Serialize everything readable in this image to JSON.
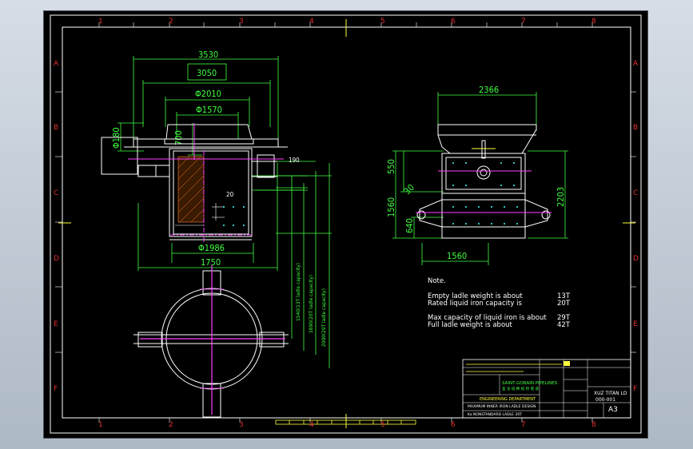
{
  "frame": {
    "columns": [
      "1",
      "2",
      "3",
      "4",
      "5",
      "6",
      "7",
      "8"
    ],
    "rows": [
      "A",
      "B",
      "C",
      "D",
      "E",
      "F"
    ]
  },
  "dimensions": {
    "d3530": "3530",
    "d3050": "3050",
    "dphi2010": "Φ2010",
    "dphi1570": "Φ1570",
    "d700": "700",
    "dphi180": "Φ180",
    "d190": "190",
    "d20": "20",
    "dphi1986": "Φ1986",
    "d1750": "1750",
    "d2366": "2366",
    "d550": "550",
    "d2203": "2203",
    "d1560": "1560",
    "d640": "640",
    "d1560b": "1560",
    "d30": "30",
    "vertical_labels": [
      "1540(13T ladle capacity)",
      "1690(20T ladle capacity)",
      "2000(29T ladle capacity)"
    ]
  },
  "notes": {
    "heading": "Note.",
    "lines": [
      {
        "label": "Empty ladle weight is about",
        "value": "13T"
      },
      {
        "label": "Rated liquid iron capacity is",
        "value": "20T"
      },
      {
        "label": "Max capacity of liquid iron is about",
        "value": "29T"
      },
      {
        "label": "Full ladle weight is about",
        "value": "42T"
      }
    ]
  },
  "title_block": {
    "company": "SAINT-GOBAIN PIPELINES",
    "company_sub": "圣 戈 班 穆 松 桥 管 道",
    "project": "ENGINEERING DEPARTMENT",
    "drawing_title_1": "MAXIMUM INNER IRON LADLE DESIGN",
    "drawing_title_2": "Ka NONSTANDARD LADLE 20T",
    "drawing_no_1": "XUZ TITAN LD",
    "drawing_no_2": "000-001",
    "size": "A3"
  },
  "colors": {
    "frame_line": "#ffffff",
    "ruler_text": "#e03030",
    "dimension": "#40ff40",
    "centerline": "#ff40ff",
    "highlight": "#ffff40",
    "hatch": "#ff8030"
  }
}
